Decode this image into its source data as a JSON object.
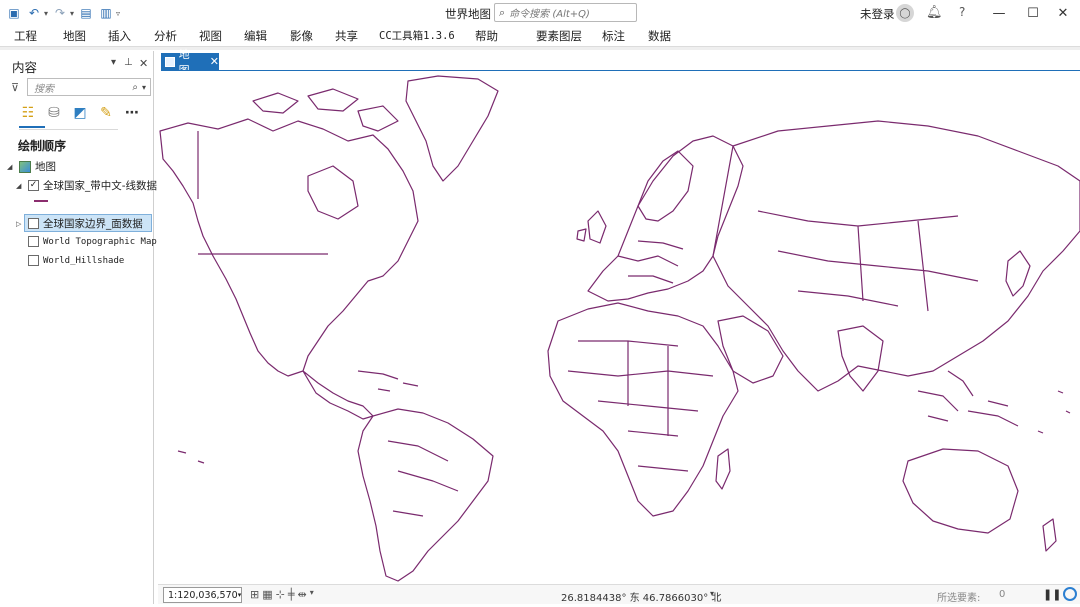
{
  "window": {
    "title": "世界地图",
    "command_search_placeholder": "命令搜索 (Alt+Q)",
    "user_status": "未登录",
    "help_glyph": "?"
  },
  "quick_access": [
    "project-icon",
    "undo-icon",
    "redo-icon",
    "open-folder-icon",
    "save-icon",
    "customize-icon"
  ],
  "menu": {
    "tabs": [
      "工程",
      "地图",
      "插入",
      "分析",
      "视图",
      "编辑",
      "影像",
      "共享",
      "CC工具箱1.3.6",
      "帮助"
    ],
    "context_tabs": [
      "要素图层",
      "标注",
      "数据"
    ]
  },
  "contents_pane": {
    "title": "内容",
    "search_placeholder": "搜索",
    "section_title": "绘制顺序",
    "map_name": "地图",
    "layers": [
      {
        "name": "全球国家_带中文-线数据",
        "checked": true,
        "expanded": true
      },
      {
        "name": "全球国家边界_面数据",
        "checked": false,
        "selected": true
      },
      {
        "name": "World Topographic Map",
        "checked": false
      },
      {
        "name": "World_Hillshade",
        "checked": false
      }
    ],
    "line_symbol_color": "#8b2d6e"
  },
  "map_view": {
    "tab_label": "地图",
    "outline_color": "#7a2a6e",
    "accent": "#1f6fb8"
  },
  "status_bar": {
    "scale": "1:120,036,570",
    "coordinates": "26.8184438° 东 46.7866030° 北",
    "selected_features_label": "所选要素:",
    "selected_features_count": "0"
  }
}
